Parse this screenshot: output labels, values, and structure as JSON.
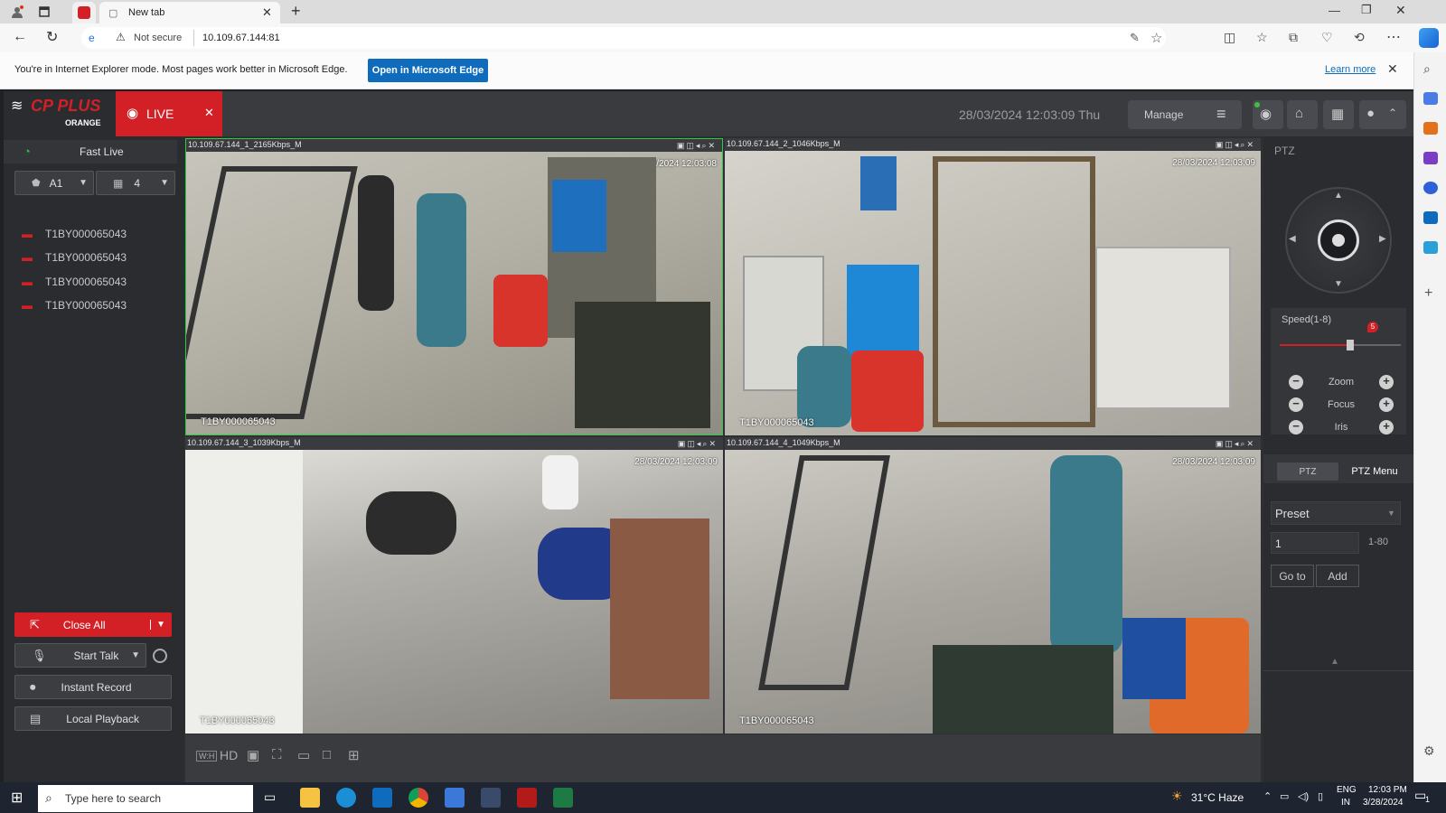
{
  "browser": {
    "tabs": [
      {
        "label": "New tab"
      }
    ],
    "address": "10.109.67.144:81",
    "security_label": "Not secure",
    "ie_mode_message": "You're in Internet Explorer mode. Most pages work better in Microsoft Edge.",
    "ie_open_button": "Open in Microsoft Edge",
    "ie_learn_more": "Learn more"
  },
  "app": {
    "brand": "CP PLUS",
    "brand_sub": "ORANGE",
    "live_tab": "LIVE",
    "datetime": "28/03/2024 12:03:09 Thu",
    "manage_label": "Manage",
    "left": {
      "fast_live": "Fast Live",
      "stream_select": "A1",
      "layout_select": "4",
      "devices": [
        "T1BY000065043",
        "T1BY000065043",
        "T1BY000065043",
        "T1BY000065043"
      ],
      "buttons": {
        "close_all": "Close All",
        "start_talk": "Start Talk",
        "instant_record": "Instant Record",
        "local_playback": "Local Playback"
      }
    },
    "cameras": [
      {
        "label": "10.109.67.144_1_2165Kbps_M",
        "timestamp": "28/03/2024 12:03:08",
        "name": "T1BY000065043"
      },
      {
        "label": "10.109.67.144_2_1046Kbps_M",
        "timestamp": "28/03/2024 12:03:09",
        "name": "T1BY000065043"
      },
      {
        "label": "10.109.67.144_3_1039Kbps_M",
        "timestamp": "28/03/2024 12:03:09",
        "name": "T1BY000065043"
      },
      {
        "label": "10.109.67.144_4_1049Kbps_M",
        "timestamp": "28/03/2024 12:03:09",
        "name": "T1BY000065043"
      }
    ],
    "bottom_bar": {
      "hd_label": "HD",
      "ratio_label": "W:H"
    },
    "ptz": {
      "title": "PTZ",
      "speed_label": "Speed(1-8)",
      "speed_value": "5",
      "speed_fraction": 0.58,
      "zoom": "Zoom",
      "focus": "Focus",
      "iris": "Iris",
      "tab_ptz": "PTZ",
      "tab_menu": "PTZ Menu",
      "preset_select": "Preset",
      "preset_value": "1",
      "preset_range": "1-80",
      "goto_btn": "Go to",
      "add_btn": "Add"
    }
  },
  "taskbar": {
    "search_placeholder": "Type here to search",
    "weather": "31°C  Haze",
    "lang": "ENG",
    "region": "IN",
    "time": "12:03 PM",
    "date": "3/28/2024",
    "notification_count": "1"
  },
  "colors": {
    "brand_red": "#d32027",
    "edge_blue": "#0f6cbd",
    "panel_dark": "#2b2c2f"
  }
}
